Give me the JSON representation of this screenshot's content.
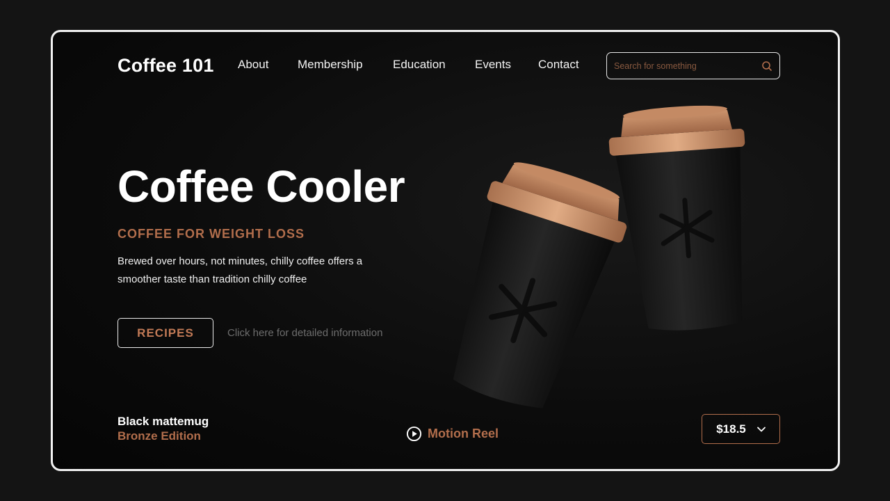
{
  "brand": {
    "logo_text": "Coffee 101"
  },
  "nav": {
    "items": [
      {
        "label": "About"
      },
      {
        "label": "Membership"
      },
      {
        "label": "Education"
      },
      {
        "label": "Events"
      },
      {
        "label": "Contact"
      }
    ]
  },
  "search": {
    "placeholder": "Search for something",
    "icon": "search-icon"
  },
  "hero": {
    "title": "Coffee Cooler",
    "subtitle": "COFFEE FOR WEIGHT LOSS",
    "description": "Brewed over hours, not minutes, chilly coffee offers a smoother taste than tradition chilly coffee",
    "cta_label": "RECIPES",
    "info_link": "Click here for detailed information"
  },
  "product": {
    "name": "Black mattemug",
    "edition": "Bronze Edition",
    "price": "$18.5"
  },
  "motion_reel": {
    "label": "Motion Reel",
    "icon": "play-circle-icon"
  },
  "colors": {
    "accent": "#b26e4c",
    "background": "#0c0c0c",
    "frame_border": "#f2f2f2",
    "cup_body": "#1c1c1c",
    "cup_lid": "#c8906a"
  }
}
